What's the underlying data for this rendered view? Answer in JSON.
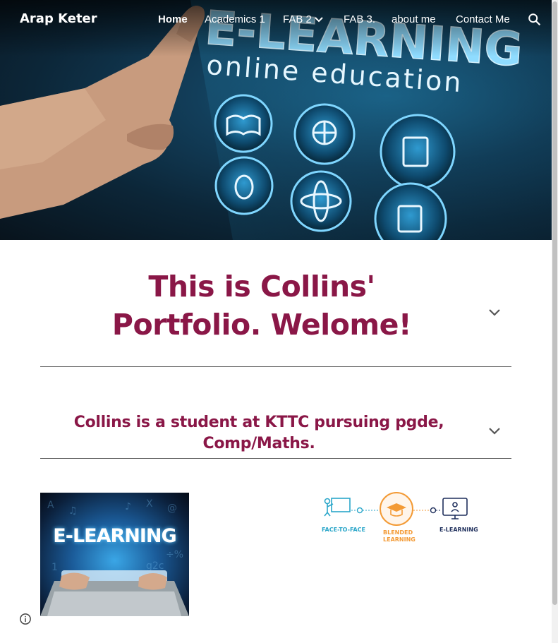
{
  "site": {
    "title": "Arap Keter"
  },
  "nav": {
    "items": [
      {
        "label": "Home",
        "active": true
      },
      {
        "label": "Academics 1"
      },
      {
        "label": "FAB 2",
        "has_dropdown": true
      },
      {
        "label": "FAB 3."
      },
      {
        "label": "about me"
      },
      {
        "label": "Contact Me"
      }
    ]
  },
  "hero": {
    "headline": "E-LEARNING",
    "subheadline": "online education"
  },
  "sections": [
    {
      "heading": "This is Collins' Portfolio. Welome!"
    },
    {
      "heading": "Collins is a student at KTTC pursuing pgde, Comp/Maths."
    }
  ],
  "images": {
    "elearning_photo": {
      "caption": "E-LEARNING"
    },
    "blended_diagram": {
      "labels": [
        "FACE-TO-FACE",
        "BLENDED LEARNING",
        "E-LEARNING"
      ]
    }
  },
  "colors": {
    "heading": "#8a1747",
    "nav_text": "#ffffff",
    "diagram_teal": "#2aa6c9",
    "diagram_orange": "#f39a35",
    "diagram_navy": "#1f2f5c"
  },
  "icons": [
    "search-icon",
    "chevron-down-icon",
    "expand-icon",
    "info-icon"
  ]
}
